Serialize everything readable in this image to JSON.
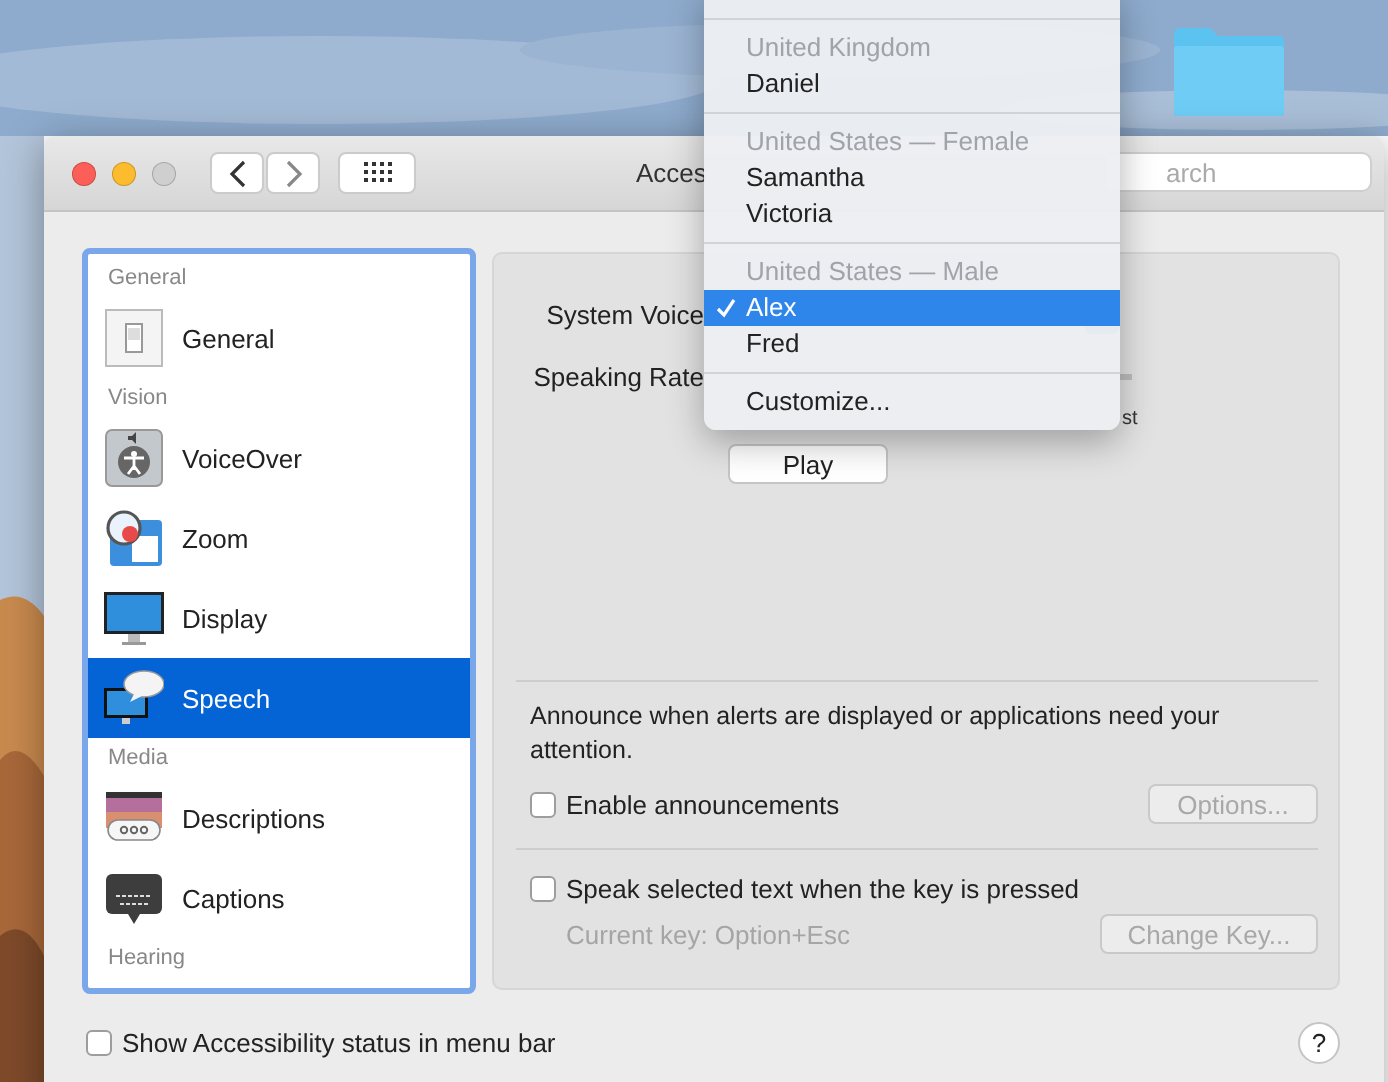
{
  "window": {
    "title": "Acces",
    "search": {
      "placeholder": "arch"
    }
  },
  "sidebar": {
    "rows": [
      {
        "kind": "header",
        "label": "General"
      },
      {
        "kind": "item",
        "label": "General",
        "selected": false
      },
      {
        "kind": "header",
        "label": "Vision"
      },
      {
        "kind": "item",
        "label": "VoiceOver",
        "selected": false
      },
      {
        "kind": "item",
        "label": "Zoom",
        "selected": false
      },
      {
        "kind": "item",
        "label": "Display",
        "selected": false
      },
      {
        "kind": "item",
        "label": "Speech",
        "selected": true
      },
      {
        "kind": "header",
        "label": "Media"
      },
      {
        "kind": "item",
        "label": "Descriptions",
        "selected": false
      },
      {
        "kind": "item",
        "label": "Captions",
        "selected": false
      },
      {
        "kind": "header",
        "label": "Hearing"
      }
    ]
  },
  "speech": {
    "system_voice_label": "System Voice",
    "speaking_rate_label": "Speaking Rate",
    "rate_max_label": "st",
    "play_button": "Play"
  },
  "announcements": {
    "description": "Announce when alerts are displayed or applications need your attention.",
    "checkbox": {
      "label": "Enable announcements",
      "checked": false
    },
    "options_button": {
      "label": "Options...",
      "disabled": true
    }
  },
  "speak_selection": {
    "checkbox": {
      "label": "Speak selected text when the key is pressed",
      "checked": false
    },
    "current_key": "Current key: Option+Esc",
    "change_key_button": {
      "label": "Change Key...",
      "disabled": true
    }
  },
  "status_checkbox": {
    "label": "Show Accessibility status in menu bar",
    "checked": false
  },
  "help_button": "?",
  "voice_menu": {
    "rows": [
      {
        "kind": "separator"
      },
      {
        "kind": "header",
        "label": "United Kingdom"
      },
      {
        "kind": "option",
        "label": "Daniel",
        "selected": false
      },
      {
        "kind": "separator"
      },
      {
        "kind": "header",
        "label": "United States — Female"
      },
      {
        "kind": "option",
        "label": "Samantha",
        "selected": false
      },
      {
        "kind": "option",
        "label": "Victoria",
        "selected": false
      },
      {
        "kind": "separator"
      },
      {
        "kind": "header",
        "label": "United States — Male"
      },
      {
        "kind": "option",
        "label": "Alex",
        "selected": true
      },
      {
        "kind": "option",
        "label": "Fred",
        "selected": false
      },
      {
        "kind": "separator"
      },
      {
        "kind": "option",
        "label": "Customize...",
        "selected": false
      }
    ]
  }
}
